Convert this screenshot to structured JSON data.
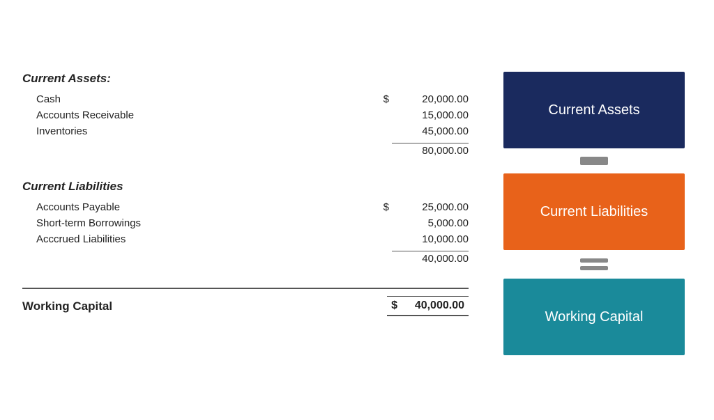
{
  "left": {
    "current_assets": {
      "title": "Current Assets:",
      "items": [
        {
          "label": "Cash",
          "dollar": "$",
          "amount": "20,000.00"
        },
        {
          "label": "Accounts Receivable",
          "dollar": "",
          "amount": "15,000.00"
        },
        {
          "label": "Inventories",
          "dollar": "",
          "amount": "45,000.00"
        }
      ],
      "subtotal": "80,000.00"
    },
    "current_liabilities": {
      "title": "Current Liabilities",
      "items": [
        {
          "label": "Accounts Payable",
          "dollar": "$",
          "amount": "25,000.00"
        },
        {
          "label": "Short-term Borrowings",
          "dollar": "",
          "amount": "5,000.00"
        },
        {
          "label": "Acccrued Liabilities",
          "dollar": "",
          "amount": "10,000.00"
        }
      ],
      "subtotal": "40,000.00"
    },
    "working_capital": {
      "label": "Working Capital",
      "dollar": "$",
      "amount": "40,000.00"
    }
  },
  "right": {
    "box1": "Current Assets",
    "box2": "Current Liabilities",
    "box3": "Working Capital"
  }
}
